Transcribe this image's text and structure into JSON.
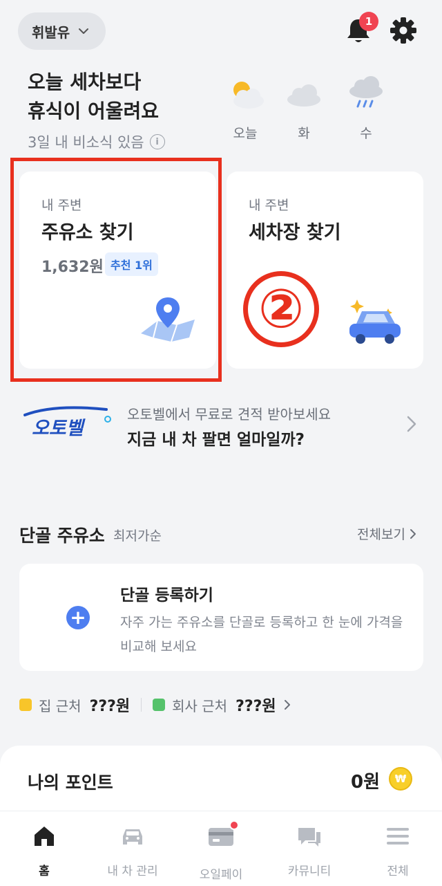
{
  "header": {
    "fuel_type": "휘발유",
    "notification_count": "1"
  },
  "weather": {
    "headline_line1": "오늘 세차보다",
    "headline_line2": "휴식이 어울려요",
    "subtext": "3일 내 비소식 있음",
    "days": [
      {
        "label": "오늘",
        "icon": "sun-cloud-icon"
      },
      {
        "label": "화",
        "icon": "cloud-icon"
      },
      {
        "label": "수",
        "icon": "rain-icon"
      }
    ]
  },
  "cards": {
    "gas": {
      "small": "내 주변",
      "title": "주유소 찾기",
      "price": "1,632원",
      "badge": "추천 1위",
      "icon": "map-pin-icon"
    },
    "wash": {
      "small": "내 주변",
      "title": "세차장 찾기",
      "icon": "car-sparkle-icon"
    },
    "annotation": "②"
  },
  "promo": {
    "logo_text": "오토벨",
    "subtitle": "오토벨에서 무료로 견적 받아보세요",
    "title": "지금 내 차 팔면 얼마일까?"
  },
  "regular": {
    "title": "단골 주유소",
    "subtitle": "최저가순",
    "see_all": "전체보기",
    "card_title": "단골 등록하기",
    "card_desc": "자주 가는 주유소를 단골로 등록하고 한 눈에 가격을 비교해 보세요",
    "home_label": "집 근처",
    "home_value": "???원",
    "work_label": "회사 근처",
    "work_value": "???원"
  },
  "points": {
    "title": "나의 포인트",
    "value": "0원",
    "coin_symbol": "₩"
  },
  "nav": {
    "items": [
      {
        "label": "홈",
        "icon": "home-icon",
        "active": true
      },
      {
        "label": "내 차 관리",
        "icon": "car-icon",
        "active": false
      },
      {
        "label": "오일페이",
        "icon": "card-icon",
        "active": false
      },
      {
        "label": "카뮤니티",
        "icon": "chat-icon",
        "active": false
      },
      {
        "label": "전체",
        "icon": "menu-icon",
        "active": false
      }
    ]
  },
  "colors": {
    "accent_blue": "#4e7ef0",
    "badge_red": "#f04452",
    "annotation_red": "#e8301e",
    "home_square": "#f8c52a",
    "work_square": "#55c26b"
  }
}
